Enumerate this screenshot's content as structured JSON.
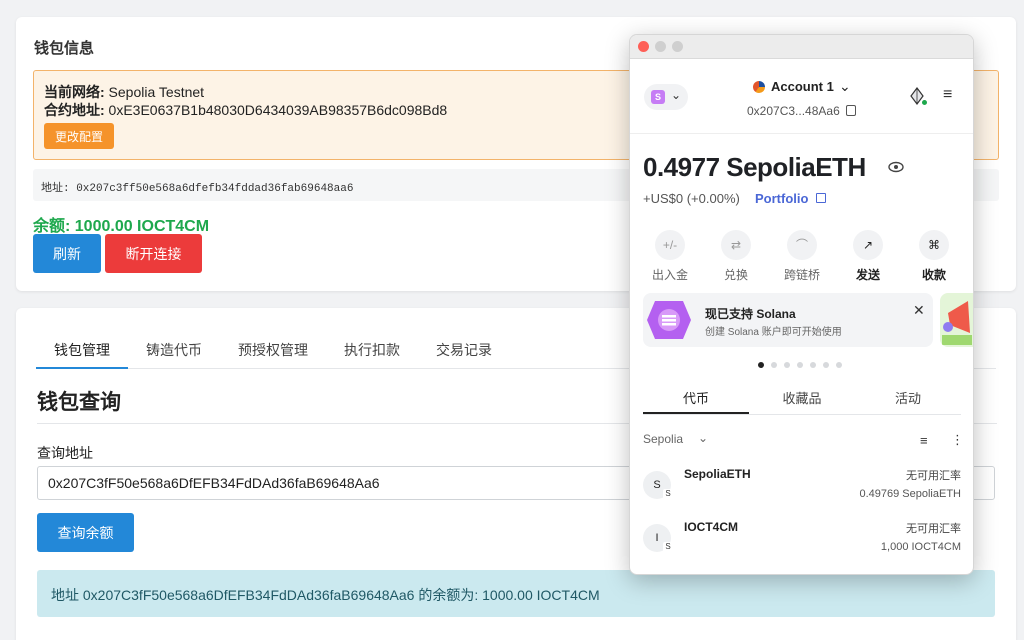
{
  "wallet_info": {
    "title": "钱包信息",
    "network_label": "当前网络:",
    "network_value": " Sepolia Testnet",
    "contract_label": "合约地址:",
    "contract_value": " 0xE3E0637B1b48030D6434039AB98357B6dc098Bd8",
    "config_button": "更改配置",
    "address_text": "地址: 0x207c3ff50e568a6dfefb34fddad36fab69648aa6",
    "balance_text": "余额: 1000.00 IOCT4CM",
    "refresh_button": "刷新",
    "disconnect_button": "断开连接"
  },
  "management": {
    "tabs": [
      "钱包管理",
      "铸造代币",
      "预授权管理",
      "执行扣款",
      "交易记录"
    ],
    "active_tab": 0,
    "section_title": "钱包查询",
    "query_label": "查询地址",
    "query_value": "0x207C3fF50e568a6DfEFB34FdDAd36faB69648Aa6",
    "query_button": "查询余额",
    "result_text": "地址 0x207C3fF50e568a6DfEFB34FdDAd36faB69648Aa6 的余额为: 1000.00 IOCT4CM"
  },
  "metamask": {
    "network_avatar": "S",
    "account_name": "Account 1",
    "account_address": "0x207C3...48Aa6",
    "balance": "0.4977 SepoliaETH",
    "usd_value": "+US$0 (+0.00%)",
    "portfolio_label": "Portfolio",
    "actions": [
      {
        "label": "出入金",
        "icon": "buy-sell-icon",
        "glyph": "+/-"
      },
      {
        "label": "兑换",
        "icon": "swap-icon",
        "glyph": "⇄"
      },
      {
        "label": "跨链桥",
        "icon": "bridge-icon",
        "glyph": "⌒"
      },
      {
        "label": "发送",
        "icon": "send-icon",
        "glyph": "↗"
      },
      {
        "label": "收款",
        "icon": "receive-icon",
        "glyph": "⌘"
      }
    ],
    "banner": {
      "title": "现已支持 Solana",
      "subtitle": "创建 Solana 账户即可开始使用"
    },
    "asset_tabs": [
      "代币",
      "收藏品",
      "活动"
    ],
    "active_asset_tab": 0,
    "network_filter": "Sepolia",
    "tokens": [
      {
        "avatar": "S",
        "badge": "S",
        "name": "SepoliaETH",
        "rate": "无可用汇率",
        "amount": "0.49769 SepoliaETH"
      },
      {
        "avatar": "I",
        "badge": "S",
        "name": "IOCT4CM",
        "rate": "无可用汇率",
        "amount": "1,000 IOCT4CM"
      }
    ],
    "colors": {
      "accent_blue": "#4a67d6",
      "primary_button": "#2388d8",
      "danger_button": "#ec3b3b",
      "warning_button": "#f5932a",
      "balance_green": "#1ea84d"
    }
  }
}
